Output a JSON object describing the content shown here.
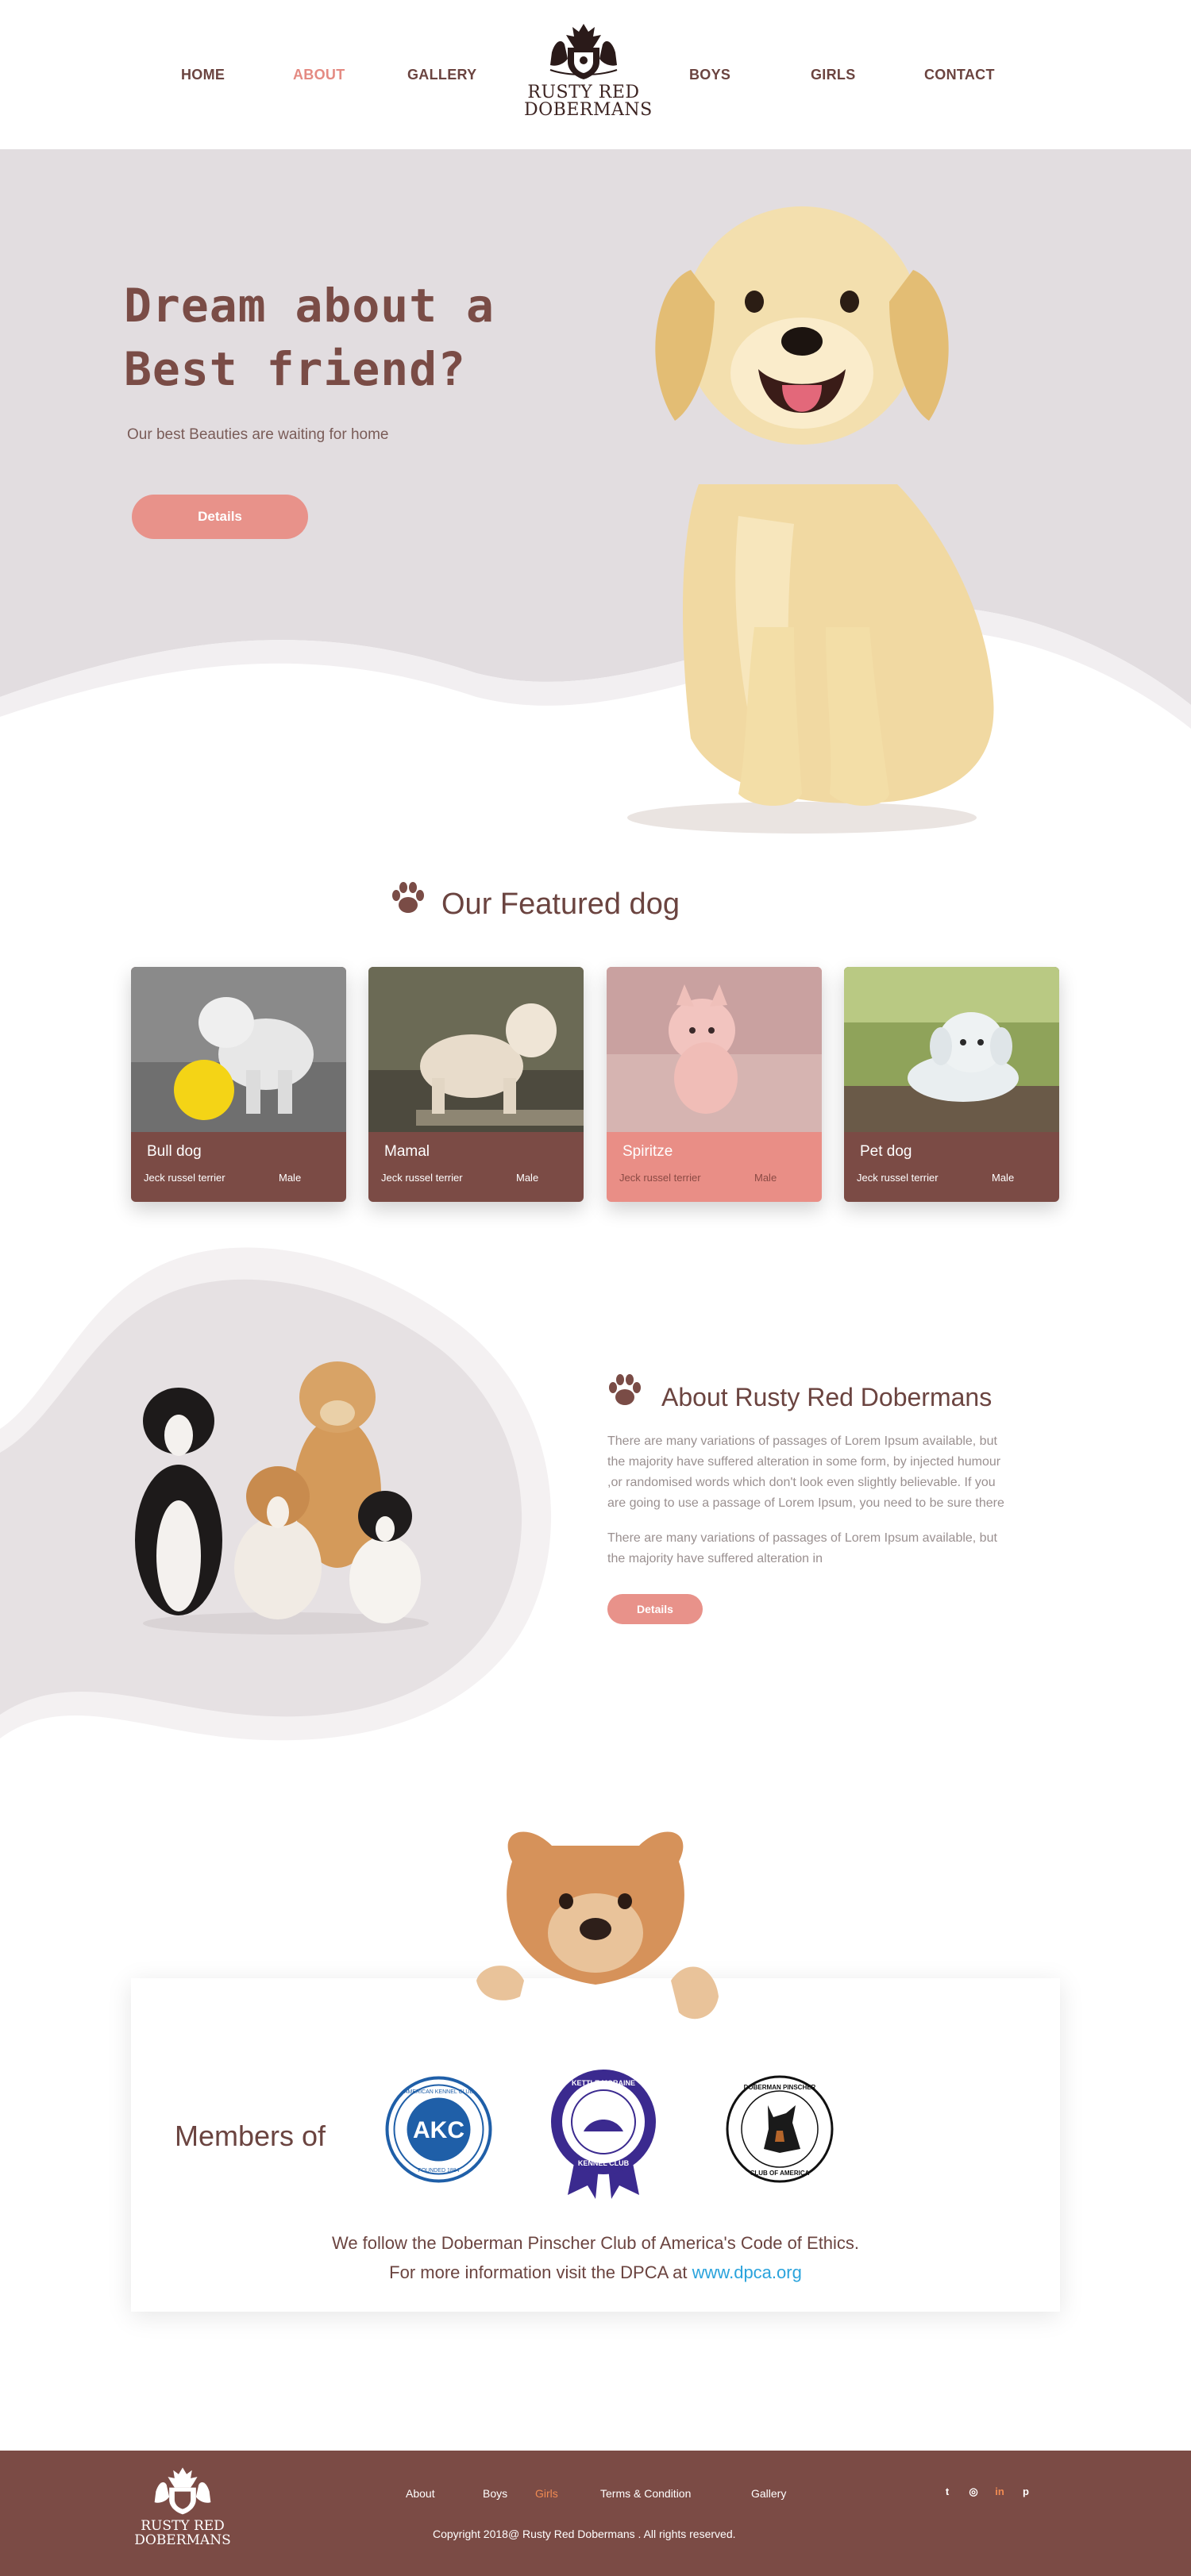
{
  "colors": {
    "accent": "#e8928a",
    "brand": "#7b4b45",
    "link": "#2aa3dc",
    "hero_bg": "#e2dde0"
  },
  "nav": {
    "items": [
      {
        "label": "HOME"
      },
      {
        "label": "ABOUT"
      },
      {
        "label": "GALLERY"
      },
      {
        "label": "BOYS"
      },
      {
        "label": "GIRLS"
      },
      {
        "label": "CONTACT"
      }
    ],
    "active": "ABOUT"
  },
  "logo": {
    "line1": "RUSTY RED",
    "line2": "DOBERMANS"
  },
  "hero": {
    "title_line1": "Dream about a",
    "title_line2": "Best friend?",
    "subtitle": "Our best Beauties are waiting for home",
    "button": "Details"
  },
  "featured": {
    "title": "Our Featured dog",
    "icon": "paw-icon",
    "cards": [
      {
        "name": "Bull dog",
        "breed": "Jeck russel terrier",
        "gender": "Male"
      },
      {
        "name": "Mamal",
        "breed": "Jeck russel terrier",
        "gender": "Male"
      },
      {
        "name": "Spiritze",
        "breed": "Jeck russel terrier",
        "gender": "Male"
      },
      {
        "name": "Pet dog",
        "breed": "Jeck russel terrier",
        "gender": "Male"
      }
    ]
  },
  "about": {
    "title": "About Rusty Red Dobermans",
    "p1_l1": "There are many variations of passages of Lorem Ipsum available, but",
    "p1_l2": "the majority have suffered alteration in some form, by injected humour",
    "p1_l3": ",or randomised words which don't look even slightly believable. If you",
    "p1_l4": "are going to use a passage of Lorem Ipsum, you need to be sure there",
    "p2_l1": "There are many variations of passages of Lorem Ipsum available, but",
    "p2_l2": "the majority have suffered alteration in",
    "button": "Details"
  },
  "members": {
    "label": "Members of",
    "logos": [
      {
        "name": "akc-logo",
        "top": "AMERICAN KENNEL CLUB",
        "center": "AKC",
        "bottom": "FOUNDED 1884"
      },
      {
        "name": "kettle-moraine-logo",
        "top": "KETTLE MORAINE",
        "bottom": "KENNEL CLUB"
      },
      {
        "name": "dpca-logo",
        "top": "DOBERMAN PINSCHER",
        "bottom": "CLUB OF AMERICA"
      }
    ],
    "line1": "We follow the Doberman Pinscher Club of America's Code of Ethics.",
    "line2_prefix": "For more information visit the DPCA at ",
    "link": "www.dpca.org"
  },
  "footer": {
    "logo_line1": "RUSTY RED",
    "logo_line2": "DOBERMANS",
    "links": [
      {
        "label": "About"
      },
      {
        "label": "Boys"
      },
      {
        "label": "Girls"
      },
      {
        "label": "Terms & Condition"
      },
      {
        "label": "Gallery"
      }
    ],
    "active": "Girls",
    "copyright": "Copyright 2018@ Rusty Red Dobermans . All rights reserved.",
    "social": [
      {
        "icon": "twitter-icon",
        "glyph": "t"
      },
      {
        "icon": "instagram-icon",
        "glyph": "◎"
      },
      {
        "icon": "linkedin-icon",
        "glyph": "in"
      },
      {
        "icon": "pinterest-icon",
        "glyph": "p"
      }
    ]
  }
}
